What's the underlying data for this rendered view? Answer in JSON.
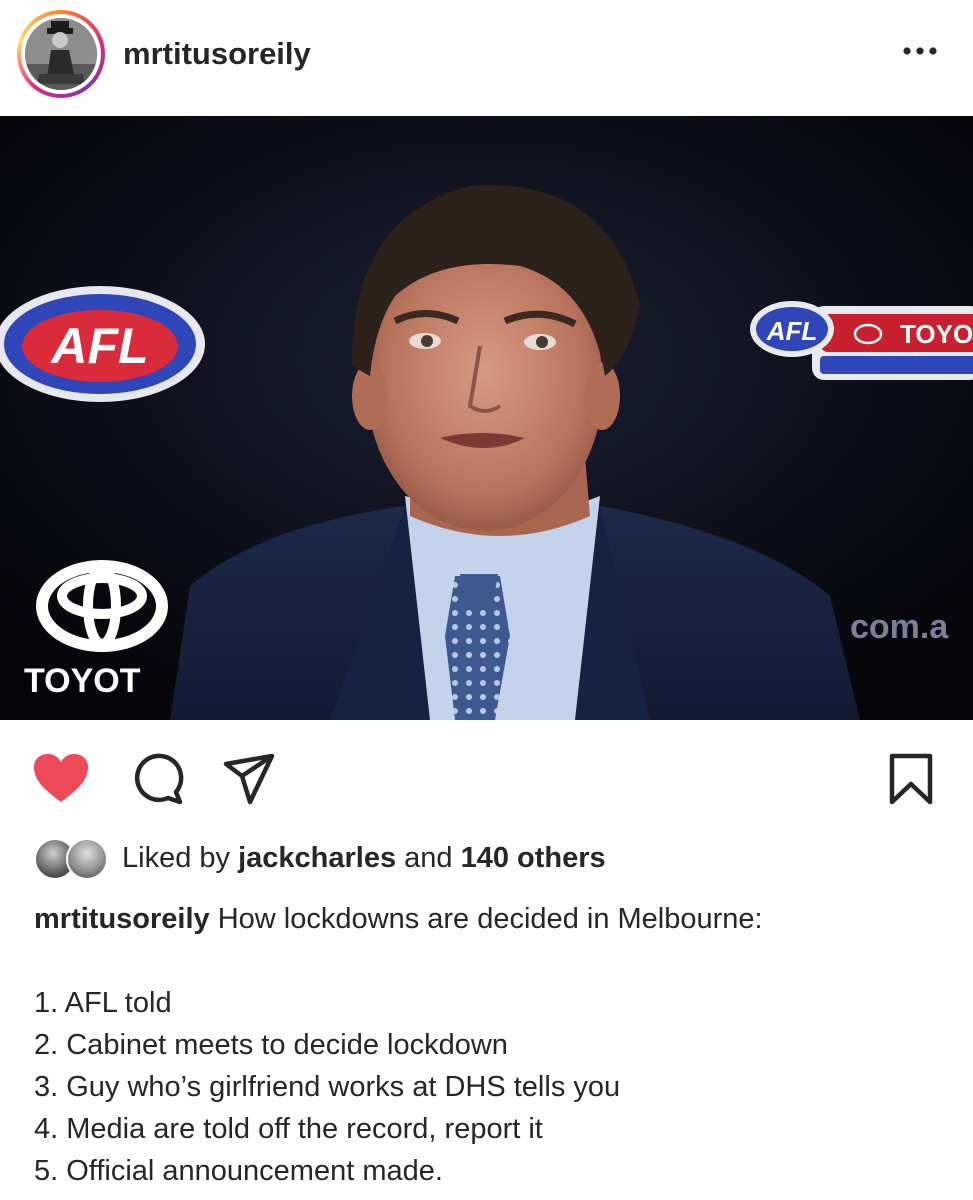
{
  "post": {
    "username": "mrtitusoreily",
    "more_icon": "ellipsis-icon",
    "image": {
      "logos": [
        "AFL",
        "TOYOTA",
        "TOYO",
        "com.a"
      ]
    }
  },
  "actions": {
    "like_icon": "heart-filled-icon",
    "comment_icon": "comment-icon",
    "share_icon": "send-icon",
    "save_icon": "bookmark-icon",
    "like_color": "#ed4956"
  },
  "likes": {
    "prefix": "Liked by",
    "user": "jackcharles",
    "connector": "and",
    "others": "140 others"
  },
  "caption": {
    "username": "mrtitusoreily",
    "headline": "How lockdowns are decided in Melbourne:",
    "items": [
      "1. AFL told",
      "2. Cabinet meets to decide lockdown",
      "3. Guy who’s girlfriend works at DHS tells you",
      "4. Media are told off the record, report it",
      "5. Official announcement made."
    ]
  }
}
